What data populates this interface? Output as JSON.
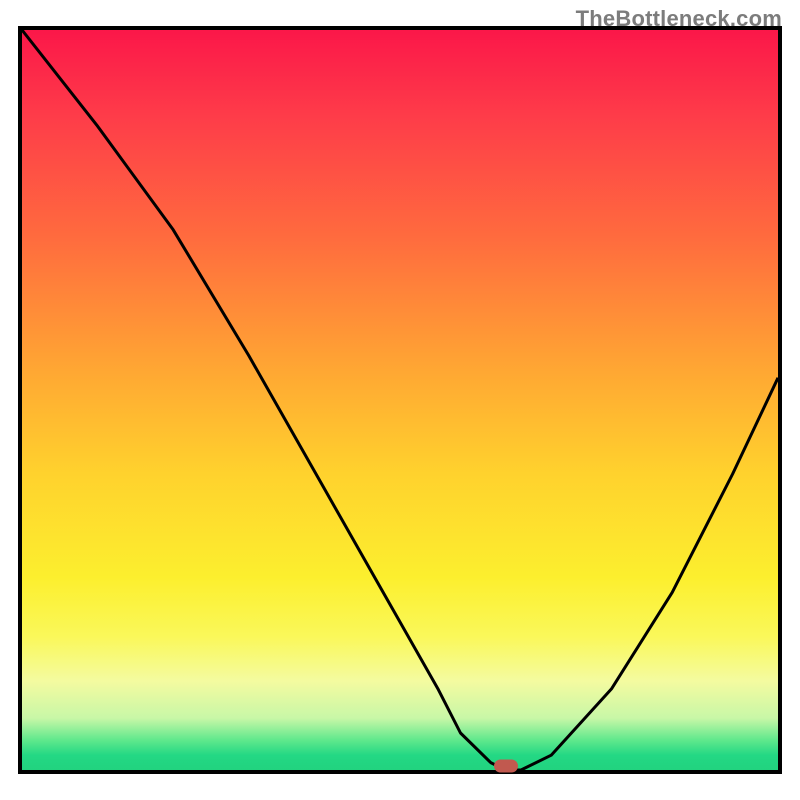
{
  "watermark": "TheBottleneck.com",
  "colors": {
    "frame": "#000000",
    "curve": "#000000",
    "marker": "#c1594f"
  },
  "chart_data": {
    "type": "line",
    "title": "",
    "xlabel": "",
    "ylabel": "",
    "xlim": [
      0,
      100
    ],
    "ylim": [
      0,
      100
    ],
    "grid": false,
    "series": [
      {
        "name": "bottleneck-curve",
        "x": [
          0,
          10,
          20,
          30,
          40,
          50,
          55,
          58,
          62,
          64,
          66,
          70,
          78,
          86,
          94,
          100
        ],
        "values": [
          100,
          87,
          73,
          56,
          38,
          20,
          11,
          5,
          1,
          0,
          0,
          2,
          11,
          24,
          40,
          53
        ]
      }
    ],
    "annotations": [
      {
        "name": "min-marker",
        "x": 64,
        "y": 0.5
      }
    ],
    "background_gradient": {
      "stops": [
        {
          "offset": 0.0,
          "color": "#fb1749"
        },
        {
          "offset": 0.12,
          "color": "#fe3d49"
        },
        {
          "offset": 0.28,
          "color": "#ff6b3e"
        },
        {
          "offset": 0.46,
          "color": "#ffa733"
        },
        {
          "offset": 0.6,
          "color": "#ffd22d"
        },
        {
          "offset": 0.74,
          "color": "#fcef2e"
        },
        {
          "offset": 0.82,
          "color": "#faf85a"
        },
        {
          "offset": 0.88,
          "color": "#f4fba0"
        },
        {
          "offset": 0.93,
          "color": "#c8f7a7"
        },
        {
          "offset": 0.96,
          "color": "#5ee88c"
        },
        {
          "offset": 0.98,
          "color": "#23d884"
        },
        {
          "offset": 1.0,
          "color": "#22d37f"
        }
      ]
    }
  }
}
